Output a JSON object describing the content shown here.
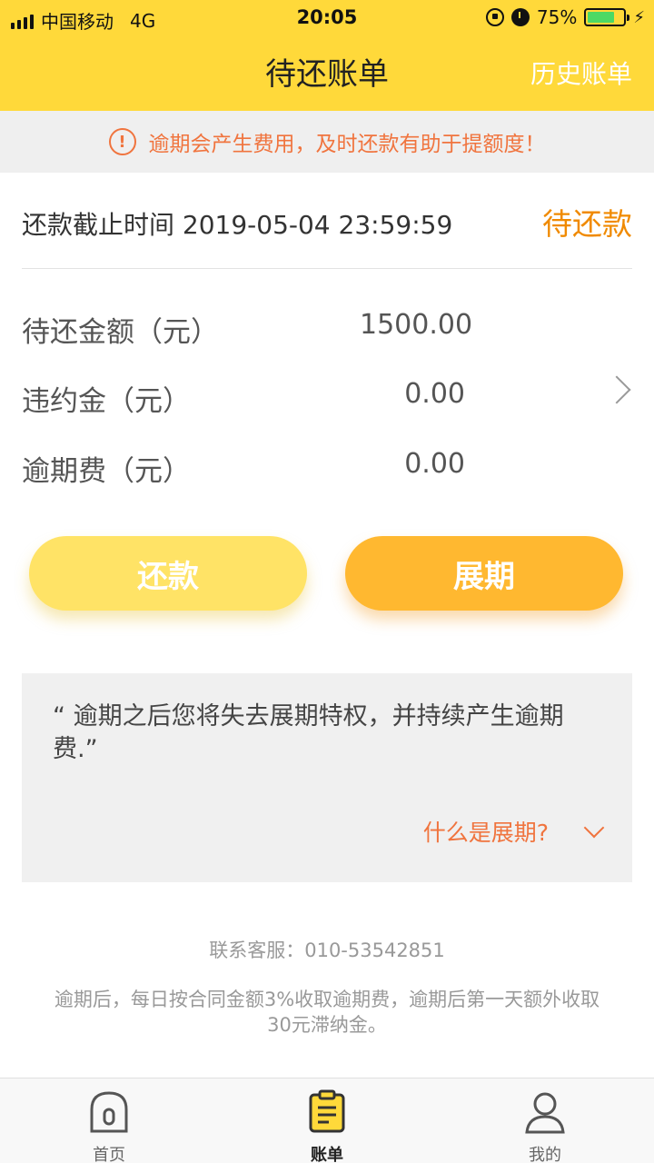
{
  "status_bar": {
    "carrier": "中国移动",
    "network": "4G",
    "time": "20:05",
    "battery": "75%",
    "battery_level": 0.75
  },
  "header": {
    "title": "待还账单",
    "history_link": "历史账单"
  },
  "notice": {
    "icon_glyph": "!",
    "text": "逾期会产生费用，及时还款有助于提额度！"
  },
  "bill": {
    "deadline_label": "还款截止时间 2019-05-04 23:59:59",
    "status": "待还款",
    "rows": [
      {
        "label": "待还金额（元）",
        "value": "1500.00"
      },
      {
        "label": "违约金（元）",
        "value": "0.00"
      },
      {
        "label": "逾期费（元）",
        "value": "0.00"
      }
    ]
  },
  "actions": {
    "repay_label": "还款",
    "extend_label": "展期"
  },
  "info": {
    "text": "“ 逾期之后您将失去展期特权，并持续产生逾期费.”",
    "link": "什么是展期?"
  },
  "footer": {
    "contact": "联系客服：010-53542851",
    "rule": "逾期后，每日按合同金额3%收取逾期费，逾期后第一天额外收取30元滞纳金。"
  },
  "tabs": [
    {
      "label": "首页",
      "icon": "home-icon",
      "active": false
    },
    {
      "label": "账单",
      "icon": "bill-icon",
      "active": true
    },
    {
      "label": "我的",
      "icon": "profile-icon",
      "active": false
    }
  ],
  "colors": {
    "header_bg": "#FFD93A",
    "accent_orange": "#F0743E",
    "status_orange": "#F08A00",
    "repay_button": "#FFE366",
    "extend_button": "#FFB830"
  }
}
